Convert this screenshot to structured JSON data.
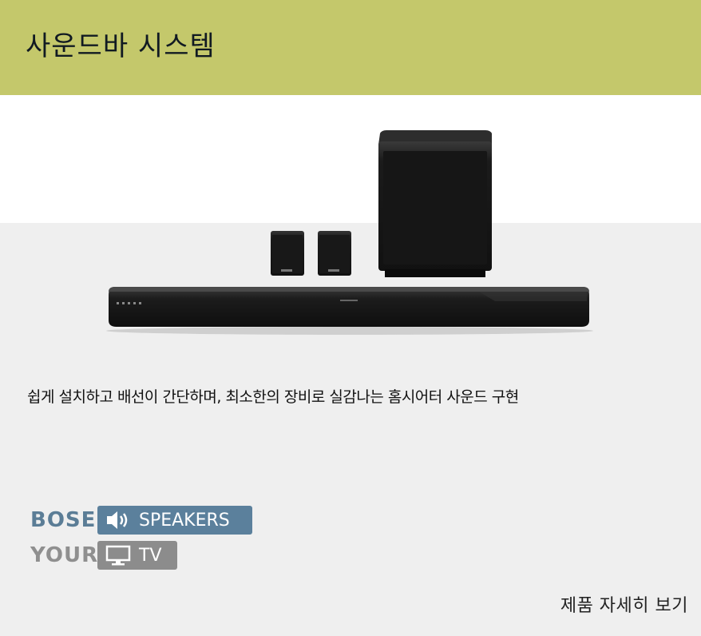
{
  "header": {
    "title": "사운드바 시스템",
    "background_color": "#c4c86b"
  },
  "product": {
    "image_icon": "soundbar-system-product-image"
  },
  "description": "쉽게 설치하고 배선이 간단하며, 최소한의 장비로 실감나는 홈시어터 사운드 구현",
  "badge": {
    "line1_word": "BOSE",
    "line1_label": "SPEAKERS",
    "line1_icon": "speaker-icon",
    "line2_word": "YOUR",
    "line2_label": "TV",
    "line2_icon": "monitor-icon",
    "colors": {
      "speakers": "#5b809c",
      "tv": "#8c8c8c"
    }
  },
  "link": {
    "label": "제품 자세히 보기"
  }
}
